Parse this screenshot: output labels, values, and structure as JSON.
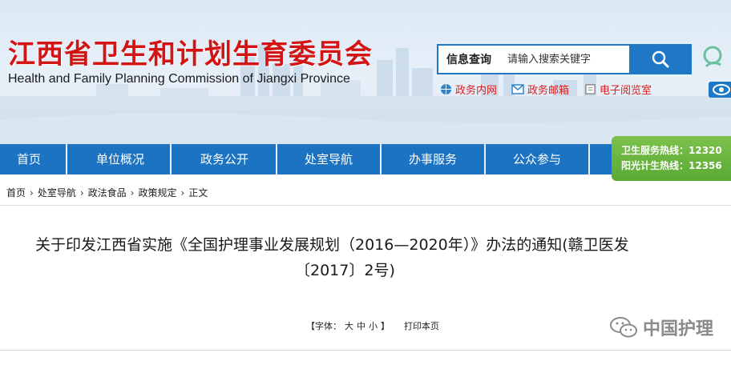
{
  "header": {
    "title": "江西省卫生和计划生育委员会",
    "subtitle": "Health and Family Planning Commission of Jiangxi Province"
  },
  "search": {
    "label": "信息查询",
    "placeholder": "请输入搜索关键字",
    "button_icon": "search-icon"
  },
  "quick_links": [
    {
      "label": "政务内网",
      "icon": "globe-icon"
    },
    {
      "label": "政务邮箱",
      "icon": "mail-icon"
    },
    {
      "label": "电子阅览室",
      "icon": "book-icon"
    }
  ],
  "nav": {
    "items": [
      "首页",
      "单位概况",
      "政务公开",
      "处室导航",
      "办事服务",
      "公众参与"
    ]
  },
  "hotline": {
    "line1": "卫生服务热线：12320",
    "line2": "阳光计生热线：12356"
  },
  "breadcrumb": [
    "首页",
    "处室导航",
    "政法食品",
    "政策规定",
    "正文"
  ],
  "article": {
    "title_line1": "关于印发江西省实施《全国护理事业发展规划（2016—2020年）》办法的通知(赣卫医发",
    "title_line2": "〔2017〕2号)",
    "font_label": "【字体：",
    "font_large": "大",
    "font_medium": "中",
    "font_small": "小",
    "font_close": "】",
    "print_label": "打印本页"
  },
  "watermark": {
    "text": "中国护理"
  },
  "colors": {
    "brand_red": "#d21414",
    "nav_blue": "#1b73c2",
    "hotline_green": "#5aa933"
  }
}
